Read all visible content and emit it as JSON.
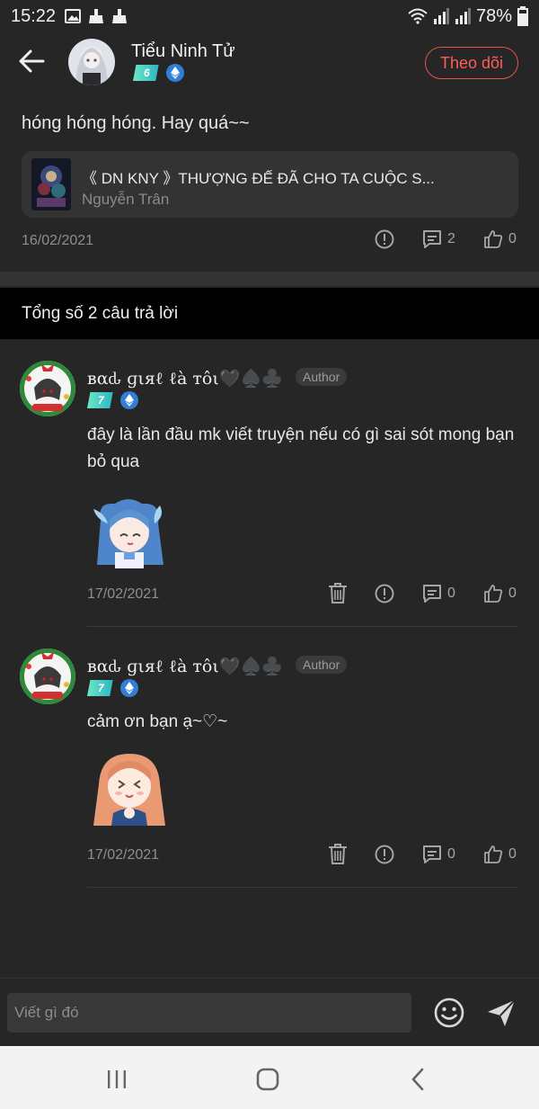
{
  "status_bar": {
    "time": "15:22",
    "battery": "78%"
  },
  "header": {
    "user_name": "Tiểu Ninh Tử",
    "level": "6",
    "follow_label": "Theo dõi"
  },
  "comment": {
    "text": "hóng hóng hóng. Hay quá~~",
    "story_title": "《 DN KNY 》THƯỢNG ĐẾ ĐÃ CHO TA CUỘC S...",
    "story_author": "Nguyễn Trân",
    "date": "16/02/2021",
    "reply_count": "2",
    "like_count": "0"
  },
  "replies_header": "Tổng số 2 câu trả lời",
  "replies": [
    {
      "name": "вαԃ ɡιяℓ ℓà тôι🖤♠️♣️",
      "tag": "Author",
      "level": "7",
      "text": "đây là lần đầu mk viết truyện nếu có gì sai sót mong bạn bỏ qua",
      "date": "17/02/2021",
      "reply_count": "0",
      "like_count": "0"
    },
    {
      "name": "вαԃ ɡιяℓ ℓà тôι🖤♠️♣️",
      "tag": "Author",
      "level": "7",
      "text": "cảm ơn bạn ạ~♡~",
      "date": "17/02/2021",
      "reply_count": "0",
      "like_count": "0"
    }
  ],
  "input": {
    "placeholder": "Viết gì đó"
  },
  "colors": {
    "accent": "#ff5c57",
    "background": "#262626",
    "level_badge": "#3fcfc4",
    "eth_badge": "#2f7fd8"
  },
  "icons": [
    "back-arrow-icon",
    "ethereum-icon",
    "report-icon",
    "comment-icon",
    "like-icon",
    "delete-icon",
    "emoji-icon",
    "send-icon"
  ]
}
